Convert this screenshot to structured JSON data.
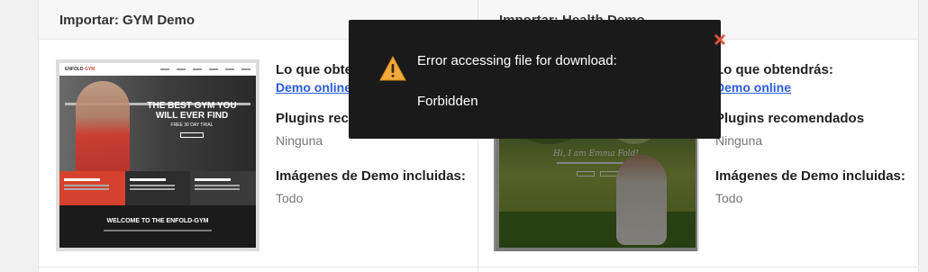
{
  "left_panel": {
    "title": "Importar: GYM Demo",
    "what_you_get_label": "Lo que obtendrás:",
    "demo_link": "Demo online",
    "plugins_label": "Plugins recomendados",
    "plugins_value": "Ninguna",
    "images_label": "Imágenes de Demo incluidas:",
    "images_value": "Todo",
    "thumb": {
      "logo_prefix": "ENFOLD",
      "logo_suffix": "GYM",
      "hero_title": "THE BEST GYM YOU WILL EVER FIND",
      "hero_sub": "FREE 30 DAY TRIAL",
      "welcome": "WELCOME TO THE ENFOLD-GYM"
    }
  },
  "right_panel": {
    "title": "Importar: Health Demo",
    "what_you_get_label": "Lo que obtendrás:",
    "demo_link": "Demo online",
    "plugins_label": "Plugins recomendados",
    "plugins_value": "Ninguna",
    "images_label": "Imágenes de Demo incluidas:",
    "images_value": "Todo",
    "thumb": {
      "hero_title": "Hi, I am Emma Fold!"
    }
  },
  "modal": {
    "message": "Error accessing file for download:",
    "detail": "Forbidden",
    "icon": "warning-icon",
    "close_icon": "close-icon"
  },
  "colors": {
    "link": "#2a5bd7",
    "modal_bg": "#1a1a1a",
    "warning": "#f2a93b",
    "close": "#e0523a"
  }
}
